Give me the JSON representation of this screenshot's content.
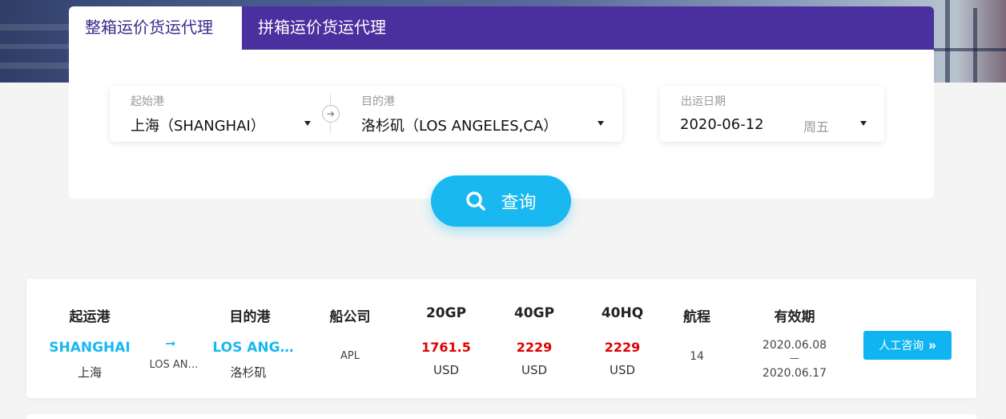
{
  "tabs": [
    {
      "label": "整箱运价货运代理",
      "active": true
    },
    {
      "label": "拼箱运价货运代理",
      "active": false
    }
  ],
  "search": {
    "origin_label": "起始港",
    "origin_value": "上海（SHANGHAI）",
    "dest_label": "目的港",
    "dest_value": "洛杉矶（LOS ANGELES,CA）",
    "date_label": "出运日期",
    "date_value": "2020-06-12",
    "weekday": "周五",
    "button_label": "查询"
  },
  "results": {
    "headers": {
      "origin": "起运港",
      "dest": "目的港",
      "carrier": "船公司",
      "gp20": "20GP",
      "gp40": "40GP",
      "hq40": "40HQ",
      "voyage": "航程",
      "validity": "有效期"
    },
    "rows": [
      {
        "origin_en": "SHANGHAI",
        "origin_cn": "上海",
        "via": "LOS AN…",
        "dest_en": "LOS ANG…",
        "dest_cn": "洛杉矶",
        "carrier": "APL",
        "gp20": "1761.5",
        "gp40": "2229",
        "hq40": "2229",
        "currency": "USD",
        "voyage": "14",
        "valid_from": "2020.06.08",
        "valid_sep": "—",
        "valid_to": "2020.06.17",
        "consult_label": "人工咨询"
      }
    ]
  },
  "colors": {
    "tab_bar": "#4a2f9e",
    "accent_blue": "#1ab8f0",
    "price_red": "#e00000"
  }
}
